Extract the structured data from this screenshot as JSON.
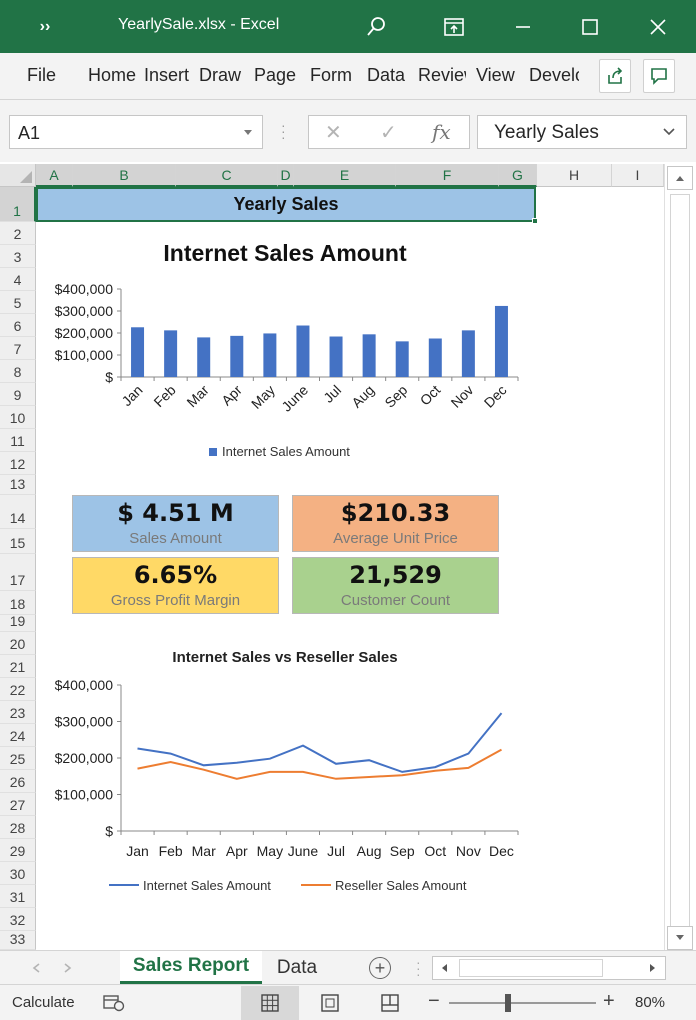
{
  "window": {
    "title": "YearlySale.xlsx  -  Excel",
    "more_icon": "double-chevron-icon",
    "search_icon": "search-icon",
    "share_icon": "share-screen-icon",
    "minimize_icon": "minimize-icon",
    "maximize_icon": "maximize-icon",
    "close_icon": "close-icon"
  },
  "ribbon": {
    "tabs": [
      "File",
      "Home",
      "Insert",
      "Draw",
      "Page",
      "Form",
      "Data",
      "Review",
      "View",
      "Developer"
    ]
  },
  "formula_bar": {
    "name_box": "A1",
    "cancel_glyph": "✕",
    "enter_glyph": "✓",
    "fx_label": "fx",
    "value": "Yearly Sales"
  },
  "grid": {
    "columns": [
      "A",
      "B",
      "C",
      "D",
      "E",
      "F",
      "G",
      "H",
      "I"
    ],
    "rows": [
      "1",
      "2",
      "3",
      "4",
      "5",
      "6",
      "7",
      "8",
      "9",
      "10",
      "11",
      "12",
      "13",
      "14",
      "15",
      "17",
      "18",
      "19",
      "20",
      "21",
      "22",
      "23",
      "24",
      "25",
      "26",
      "27",
      "28",
      "29",
      "30",
      "31",
      "32",
      "33"
    ]
  },
  "sheet_content": {
    "title": "Yearly Sales",
    "kpis": [
      {
        "value": "$ 4.51 M",
        "label": "Sales Amount",
        "color": "#9dc3e6"
      },
      {
        "value": "$210.33",
        "label": "Average Unit Price",
        "color": "#f4b183"
      },
      {
        "value": "6.65%",
        "label": "Gross Profit Margin",
        "color": "#ffd966"
      },
      {
        "value": "21,529",
        "label": "Customer Count",
        "color": "#a9d18e"
      }
    ]
  },
  "chart_data": [
    {
      "type": "bar",
      "title": "Internet Sales Amount",
      "categories": [
        "Jan",
        "Feb",
        "Mar",
        "Apr",
        "May",
        "June",
        "Jul",
        "Aug",
        "Sep",
        "Oct",
        "Nov",
        "Dec"
      ],
      "series": [
        {
          "name": "Internet Sales Amount",
          "color": "#4472c4",
          "values": [
            226000,
            212000,
            180000,
            187000,
            198000,
            234000,
            184000,
            194000,
            162000,
            175000,
            212000,
            323000
          ]
        }
      ],
      "ylim": [
        0,
        400000
      ],
      "yticks": [
        "$400,000",
        "$300,000",
        "$200,000",
        "$100,000",
        "$"
      ],
      "legend": "bottom",
      "grid": false
    },
    {
      "type": "line",
      "title": "Internet Sales vs Reseller Sales",
      "categories": [
        "Jan",
        "Feb",
        "Mar",
        "Apr",
        "May",
        "June",
        "Jul",
        "Aug",
        "Sep",
        "Oct",
        "Nov",
        "Dec"
      ],
      "series": [
        {
          "name": "Internet Sales Amount",
          "color": "#4472c4",
          "values": [
            226000,
            212000,
            180000,
            187000,
            198000,
            234000,
            184000,
            194000,
            162000,
            175000,
            212000,
            323000
          ]
        },
        {
          "name": "Reseller Sales Amount",
          "color": "#ed7d31",
          "values": [
            171000,
            189000,
            168000,
            143000,
            162000,
            162000,
            143000,
            148000,
            153000,
            165000,
            173000,
            223000
          ]
        }
      ],
      "ylim": [
        0,
        400000
      ],
      "yticks": [
        "$400,000",
        "$300,000",
        "$200,000",
        "$100,000",
        "$"
      ],
      "legend": "bottom",
      "grid": false
    }
  ],
  "sheet_tabs": {
    "tabs": [
      "Sales Report",
      "Data"
    ],
    "active": "Sales Report",
    "add_icon": "add-sheet-icon"
  },
  "status_bar": {
    "mode": "Calculate",
    "zoom": "80%"
  }
}
